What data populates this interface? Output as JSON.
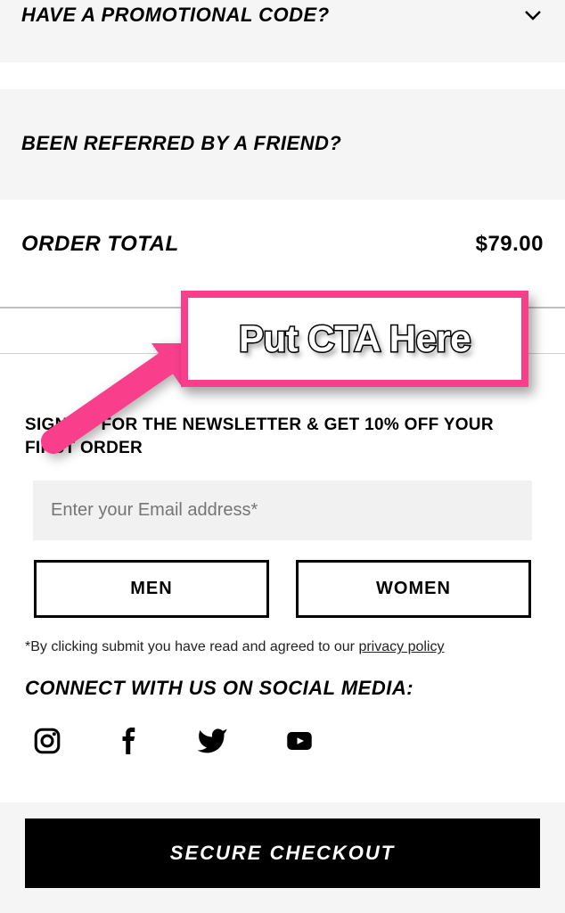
{
  "promo": {
    "label": "HAVE A PROMOTIONAL CODE?"
  },
  "referred": {
    "label": "BEEN REFERRED BY A FRIEND?"
  },
  "order": {
    "label": "ORDER TOTAL",
    "total": "$79.00"
  },
  "annotation": {
    "cta_text": "Put CTA Here"
  },
  "newsletter": {
    "title": "SIGN UP FOR THE NEWSLETTER & GET 10% OFF YOUR FIRST ORDER",
    "email_placeholder": "Enter your Email address*",
    "buttons": {
      "men": "MEN",
      "women": "WOMEN"
    },
    "disclaimer_prefix": "*By clicking submit you have read and agreed to our ",
    "disclaimer_link": "privacy policy"
  },
  "social": {
    "heading": "CONNECT WITH US ON SOCIAL MEDIA:"
  },
  "footer": {
    "checkout": "SECURE CHECKOUT"
  }
}
